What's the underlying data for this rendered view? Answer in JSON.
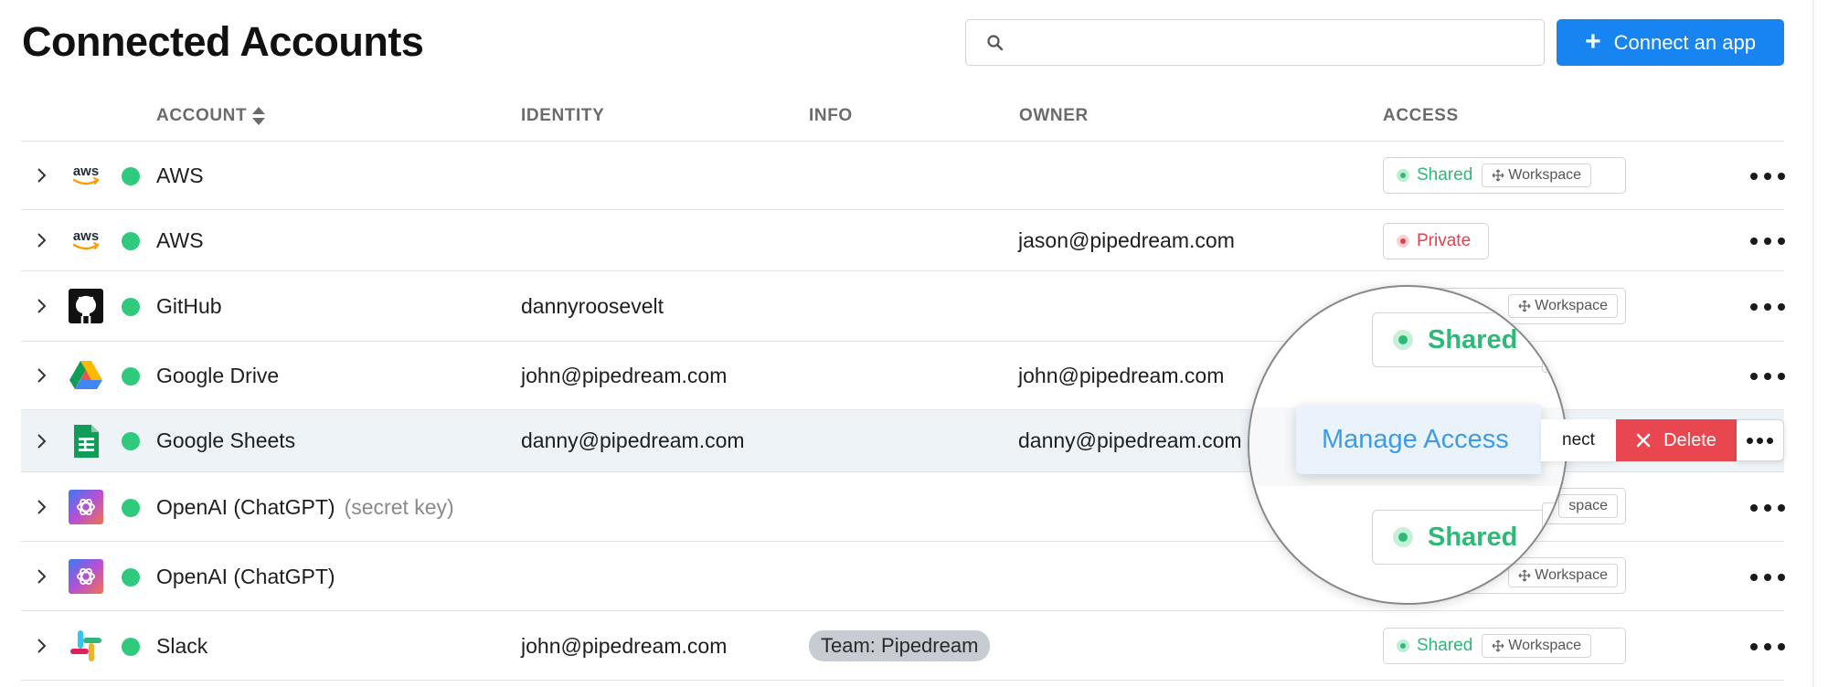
{
  "header": {
    "title": "Connected Accounts",
    "search_placeholder": "",
    "search_value": "",
    "connect_label": "Connect an app",
    "connect_icon": "plus-icon"
  },
  "columns": {
    "account": "ACCOUNT",
    "identity": "IDENTITY",
    "info": "INFO",
    "owner": "OWNER",
    "access": "ACCESS"
  },
  "rows": [
    {
      "app": "AWS",
      "note": "",
      "identity": "",
      "info": "",
      "owner": "",
      "access": "Shared",
      "scope": "Workspace",
      "status": "connected"
    },
    {
      "app": "AWS",
      "note": "",
      "identity": "",
      "info": "",
      "owner": "jason@pipedream.com",
      "access": "Private",
      "scope": "",
      "status": "connected"
    },
    {
      "app": "GitHub",
      "note": "",
      "identity": "dannyroosevelt",
      "info": "",
      "owner": "",
      "access": "",
      "scope": "Workspace",
      "status": "connected"
    },
    {
      "app": "Google Drive",
      "note": "",
      "identity": "john@pipedream.com",
      "info": "",
      "owner": "john@pipedream.com",
      "access": "",
      "scope": "",
      "status": "connected"
    },
    {
      "app": "Google Sheets",
      "note": "",
      "identity": "danny@pipedream.com",
      "info": "",
      "owner": "danny@pipedream.com",
      "access": "",
      "scope": "",
      "status": "connected"
    },
    {
      "app": "OpenAI (ChatGPT)",
      "note": "(secret key)",
      "identity": "",
      "info": "",
      "owner": "",
      "access": "",
      "scope": "space",
      "status": "connected"
    },
    {
      "app": "OpenAI (ChatGPT)",
      "note": "",
      "identity": "",
      "info": "",
      "owner": "",
      "access": "",
      "scope": "Workspace",
      "status": "connected"
    },
    {
      "app": "Slack",
      "note": "",
      "identity": "john@pipedream.com",
      "info": "Team: Pipedream",
      "owner": "",
      "access": "Shared",
      "scope": "Workspace",
      "status": "connected"
    }
  ],
  "hover_actions": {
    "manage_access": "Manage Access",
    "reconnect_fragment": "nect",
    "delete": "Delete"
  },
  "zoom": {
    "top_badge": "Shared",
    "bottom_badge": "Shared"
  },
  "colors": {
    "accent": "#1784f2",
    "status_connected": "#2fca7e",
    "shared_text": "#2fb978",
    "private_text": "#e2414c",
    "delete_bg": "#e9474f",
    "manage_access_text": "#3f9be6",
    "highlight_row": "#edf3f7"
  }
}
